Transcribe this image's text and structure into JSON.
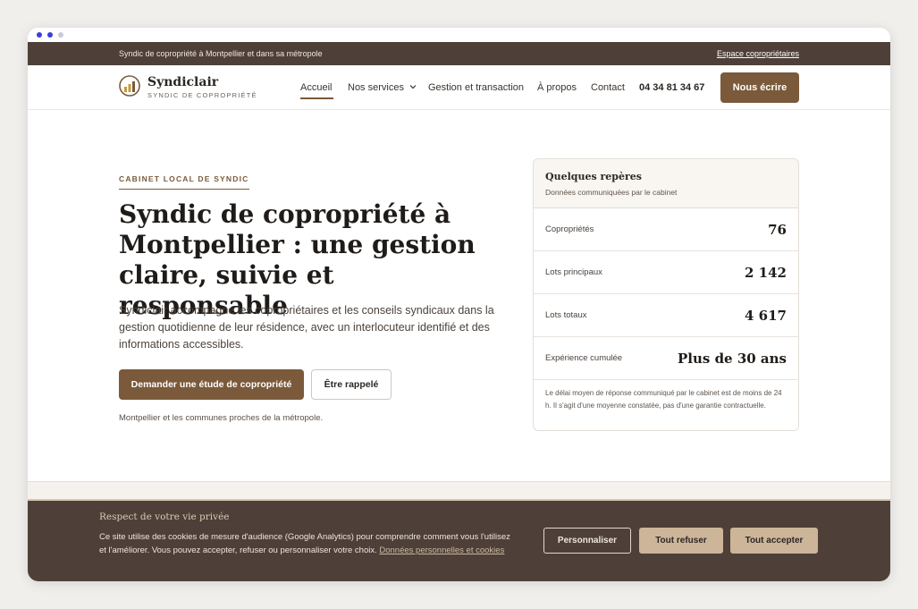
{
  "topbar": {
    "tagline": "Syndic de copropriété à Montpellier et dans sa métropole",
    "owner_space_link": "Espace copropriétaires"
  },
  "header": {
    "brand_name": "Syndiclair",
    "brand_subtitle": "SYNDIC DE COPROPRIÉTÉ",
    "logo_icon": "bar-chart-logo-icon",
    "nav": {
      "home": "Accueil",
      "services": "Nos services",
      "management": "Gestion et transaction",
      "about": "À propos",
      "contact": "Contact"
    },
    "chevron_icon": "chevron-down-icon",
    "phone": "04 34 81 34 67",
    "cta": "Nous écrire"
  },
  "hero": {
    "eyebrow": "CABINET LOCAL DE SYNDIC",
    "title": "Syndic de copropriété à Montpellier : une gestion claire, suivie et responsable",
    "lead": "Syndiclair accompagne les copropriétaires et les conseils syndicaux dans la gestion quotidienne de leur résidence, avec un interlocuteur identifié et des informations accessibles.",
    "primary_button": "Demander une étude de copropriété",
    "secondary_button": "Être rappelé",
    "note": "Montpellier et les communes proches de la métropole."
  },
  "facts_card": {
    "title": "Quelques repères",
    "subtitle": "Données communiquées par le cabinet",
    "rows": [
      {
        "label": "Copropriétés",
        "value": "76"
      },
      {
        "label": "Lots principaux",
        "value": "2 142"
      },
      {
        "label": "Lots totaux",
        "value": "4 617"
      },
      {
        "label": "Expérience cumulée",
        "value": "Plus de 30 ans"
      }
    ],
    "footnote": "Le délai moyen de réponse communiqué par le cabinet est de moins de 24 h. Il s'agit d'une moyenne constatée, pas d'une garantie contractuelle."
  },
  "cookie_banner": {
    "title": "Respect de votre vie privée",
    "text": "Ce site utilise des cookies de mesure d'audience (Google Analytics) pour comprendre comment vous l'utilisez et l'améliorer. Vous pouvez accepter, refuser ou personnaliser votre choix.",
    "link": "Données personnelles et cookies",
    "customize_button": "Personnaliser",
    "refuse_button": "Tout refuser",
    "accept_button": "Tout accepter"
  },
  "colors": {
    "brand_brown": "#7a5a3a",
    "dark_bar": "#4e4038",
    "cookie_button": "#cdb59a"
  }
}
